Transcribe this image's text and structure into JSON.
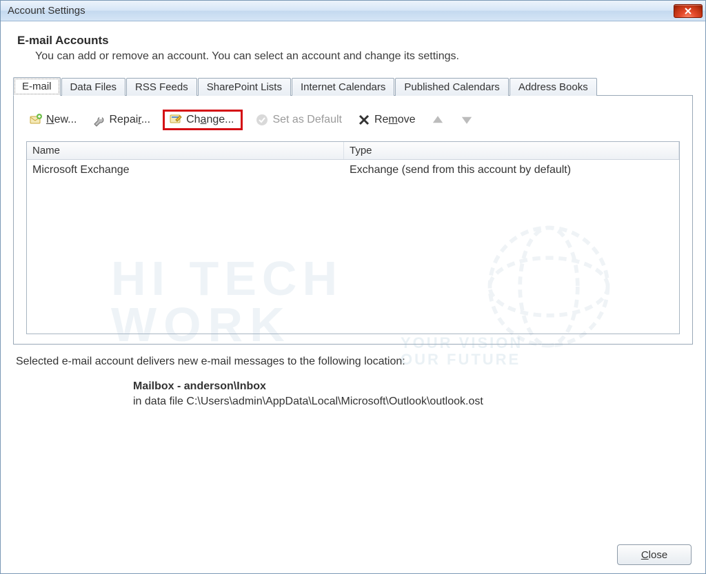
{
  "window": {
    "title": "Account Settings"
  },
  "header": {
    "title": "E-mail Accounts",
    "description": "You can add or remove an account. You can select an account and change its settings."
  },
  "tabs": [
    {
      "label": "E-mail",
      "active": true
    },
    {
      "label": "Data Files"
    },
    {
      "label": "RSS Feeds"
    },
    {
      "label": "SharePoint Lists"
    },
    {
      "label": "Internet Calendars"
    },
    {
      "label": "Published Calendars"
    },
    {
      "label": "Address Books"
    }
  ],
  "toolbar": {
    "new": "New...",
    "repair": "Repair...",
    "change": "Change...",
    "set_default": "Set as Default",
    "remove": "Remove"
  },
  "table": {
    "columns": {
      "name": "Name",
      "type": "Type"
    },
    "rows": [
      {
        "name": "Microsoft Exchange",
        "type": "Exchange (send from this account by default)"
      }
    ]
  },
  "location": {
    "intro": "Selected e-mail account delivers new e-mail messages to the following location:",
    "mailbox": "Mailbox - anderson\\Inbox",
    "datafile": "in data file C:\\Users\\admin\\AppData\\Local\\Microsoft\\Outlook\\outlook.ost"
  },
  "footer": {
    "close": "Close"
  },
  "watermark": {
    "line1": "HI TECH",
    "line2": "WORK",
    "tag1": "YOUR VISION",
    "tag2": "OUR FUTURE"
  }
}
